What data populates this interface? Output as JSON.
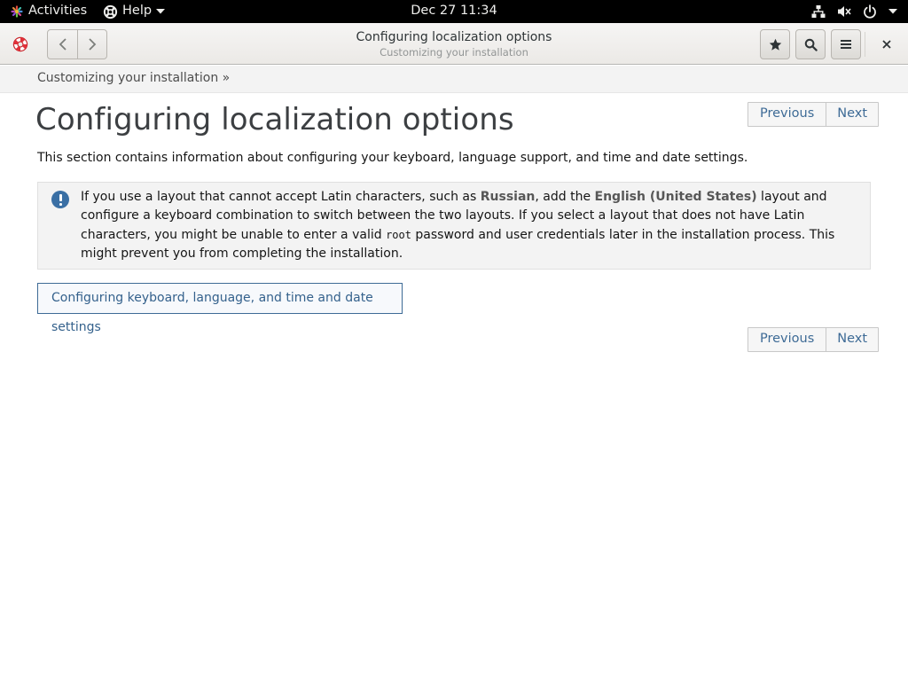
{
  "topbar": {
    "activities_label": "Activities",
    "help_label": "Help",
    "clock": "Dec 27  11:34",
    "status_icons": [
      "network-icon",
      "volume-muted-icon",
      "power-icon",
      "chevron-down-icon"
    ]
  },
  "headerbar": {
    "title": "Configuring localization options",
    "subtitle": "Customizing your installation",
    "buttons": [
      "back-icon",
      "forward-icon",
      "bookmark-star-icon",
      "search-icon",
      "menu-icon",
      "close-icon"
    ]
  },
  "breadcrumb": {
    "text": "Customizing your installation »"
  },
  "content": {
    "title": "Configuring localization options",
    "intro": "This section contains information about configuring your keyboard, language support, and time and date settings.",
    "pager_top": {
      "previous": "Previous",
      "next": "Next"
    },
    "pager_bottom": {
      "previous": "Previous",
      "next": "Next"
    },
    "note": {
      "icon": "important-icon",
      "p1": "If you use a layout that cannot accept Latin characters, such as ",
      "em1": "Russian",
      "p2": ", add the ",
      "em2": "English (United States)",
      "p3": " layout and configure a keyboard combination to switch between the two layouts. If you select a layout that does not have Latin characters, you might be unable to enter a valid ",
      "code": "root",
      "p4": " password and user credentials later in the installation process. This might prevent you from completing the installation."
    },
    "link_label": "Configuring keyboard, language, and time and date settings"
  },
  "colors": {
    "link": "#3e6b96",
    "note_background": "#f3f3f3",
    "topbar": "#000000"
  }
}
